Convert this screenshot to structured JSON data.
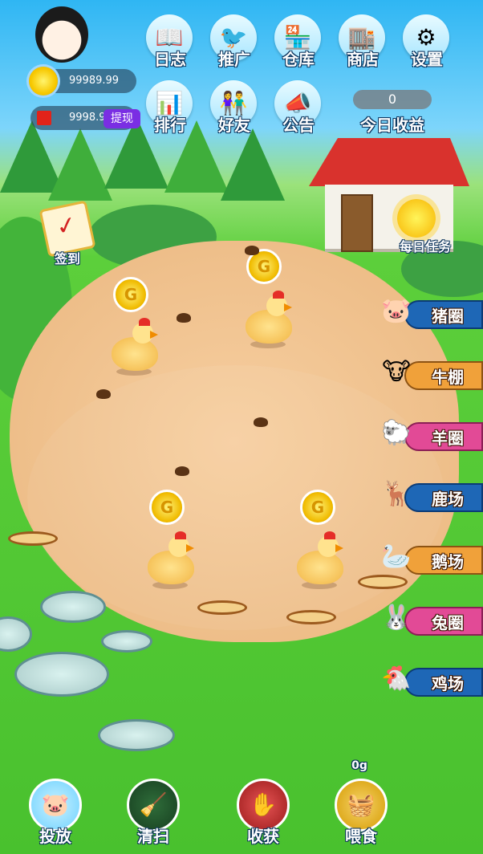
{
  "resources": {
    "sun_amount": "99989.99",
    "cash_amount": "9998.99",
    "withdraw_label": "提现"
  },
  "top_menu": [
    {
      "label": "日志",
      "icon": "book-icon"
    },
    {
      "label": "推广",
      "icon": "bird-icon"
    },
    {
      "label": "仓库",
      "icon": "warehouse-icon"
    },
    {
      "label": "商店",
      "icon": "shop-icon"
    },
    {
      "label": "设置",
      "icon": "gear-icon"
    },
    {
      "label": "排行",
      "icon": "ranking-icon"
    },
    {
      "label": "好友",
      "icon": "friends-icon"
    },
    {
      "label": "公告",
      "icon": "megaphone-icon"
    }
  ],
  "today_income": {
    "value": "0",
    "label": "今日收益"
  },
  "sign_in": {
    "label": "签到"
  },
  "daily_tasks": {
    "label": "每日任务"
  },
  "pens": [
    {
      "label": "猪圈",
      "icon": "pig-icon"
    },
    {
      "label": "牛棚",
      "icon": "cow-icon"
    },
    {
      "label": "羊圈",
      "icon": "sheep-icon"
    },
    {
      "label": "鹿场",
      "icon": "deer-icon"
    },
    {
      "label": "鹅场",
      "icon": "goose-icon"
    },
    {
      "label": "兔圈",
      "icon": "rabbit-icon"
    },
    {
      "label": "鸡场",
      "icon": "chicken-icon"
    }
  ],
  "bottom_bar": [
    {
      "label": "投放",
      "icon": "pig-release-icon"
    },
    {
      "label": "清扫",
      "icon": "broom-icon"
    },
    {
      "label": "收获",
      "icon": "harvest-hand-icon"
    },
    {
      "label": "喂食",
      "icon": "feed-bag-icon",
      "weight": "0g"
    }
  ]
}
